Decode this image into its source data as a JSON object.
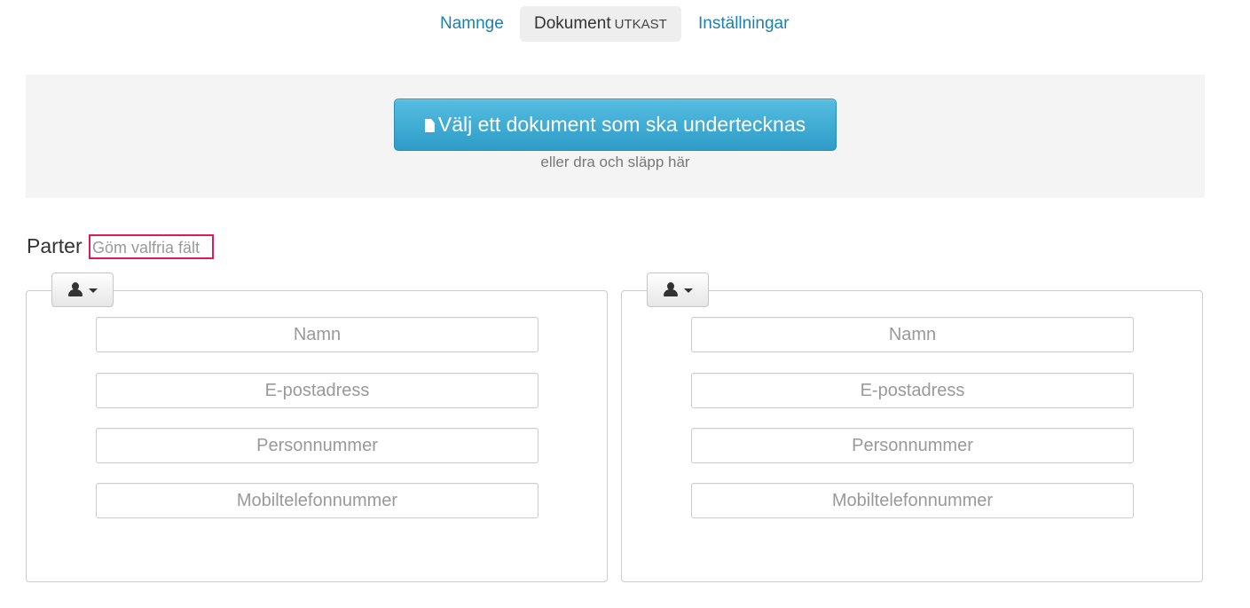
{
  "tabs": {
    "name_tab": "Namnge",
    "document_tab": "Dokument",
    "document_tag": "UTKAST",
    "settings_tab": "Inställningar"
  },
  "upload": {
    "button_label": "Välj ett dokument som ska undertecknas",
    "hint": "eller dra och släpp här"
  },
  "parties": {
    "title": "Parter",
    "toggle_optional": "Göm valfria fält",
    "fields": {
      "name_placeholder": "Namn",
      "email_placeholder": "E-postadress",
      "personal_number_placeholder": "Personnummer",
      "mobile_placeholder": "Mobiltelefonnummer"
    }
  },
  "colors": {
    "link": "#1f7fae",
    "primary_button": "#2e9cc8",
    "highlight_box": "#e0195f"
  },
  "icons": {
    "upload": "file-icon",
    "role": "user-icon",
    "dropdown": "caret-down-icon"
  }
}
